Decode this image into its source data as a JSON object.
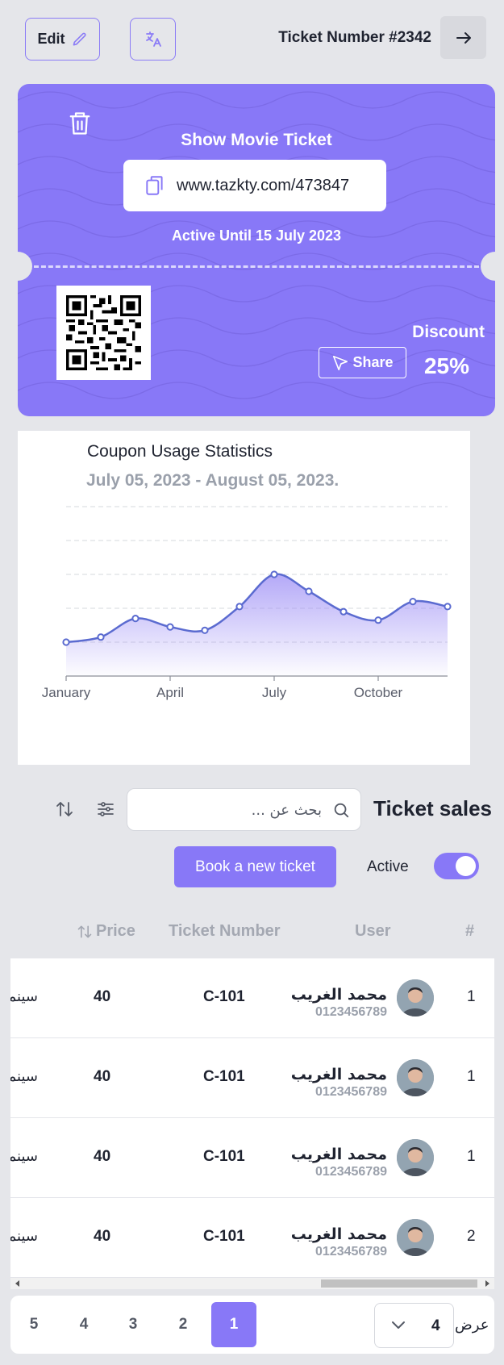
{
  "header": {
    "edit_label": "Edit",
    "ticket_title": "Ticket Number #2342"
  },
  "ticket": {
    "show_title": "Show Movie Ticket",
    "url": "www.tazkty.com/473847",
    "active_until": "Active Until 15 July 2023",
    "discount_label": "Discount",
    "discount_value": "25%",
    "share_label": "Share",
    "accent": "#8878f7"
  },
  "chart": {
    "title": "Coupon Usage Statistics",
    "subtitle": "July 05, 2023 - August 05, 2023."
  },
  "chart_data": {
    "type": "area",
    "x_ticks": [
      "January",
      "April",
      "July",
      "October"
    ],
    "x": [
      0,
      1,
      2,
      3,
      4,
      5,
      6,
      7,
      8,
      9,
      10,
      11
    ],
    "values": [
      20,
      23,
      34,
      29,
      27,
      41,
      60,
      50,
      38,
      33,
      44,
      41
    ],
    "ylim": [
      0,
      100
    ],
    "grid": true,
    "color": "#5b6bd0"
  },
  "sales": {
    "title": "Ticket sales",
    "search_placeholder": "بحث عن ...",
    "book_label": "Book a new ticket",
    "active_label": "Active",
    "active_on": true
  },
  "table": {
    "headers": {
      "hash": "#",
      "user": "User",
      "ticket": "Ticket Number",
      "price": "Price"
    },
    "rows": [
      {
        "num": "1",
        "name": "محمد الغريب",
        "phone": "0123456789",
        "ticket": "C-101",
        "price": "40",
        "cut": "سينما"
      },
      {
        "num": "1",
        "name": "محمد الغريب",
        "phone": "0123456789",
        "ticket": "C-101",
        "price": "40",
        "cut": "سينما"
      },
      {
        "num": "1",
        "name": "محمد الغريب",
        "phone": "0123456789",
        "ticket": "C-101",
        "price": "40",
        "cut": "سينما"
      },
      {
        "num": "2",
        "name": "محمد الغريب",
        "phone": "0123456789",
        "ticket": "C-101",
        "price": "40",
        "cut": "سينما"
      }
    ]
  },
  "pagination": {
    "pages": [
      "1",
      "2",
      "3",
      "4",
      "5"
    ],
    "active_page": "1",
    "per_page": "4",
    "show_label": "عرض"
  }
}
